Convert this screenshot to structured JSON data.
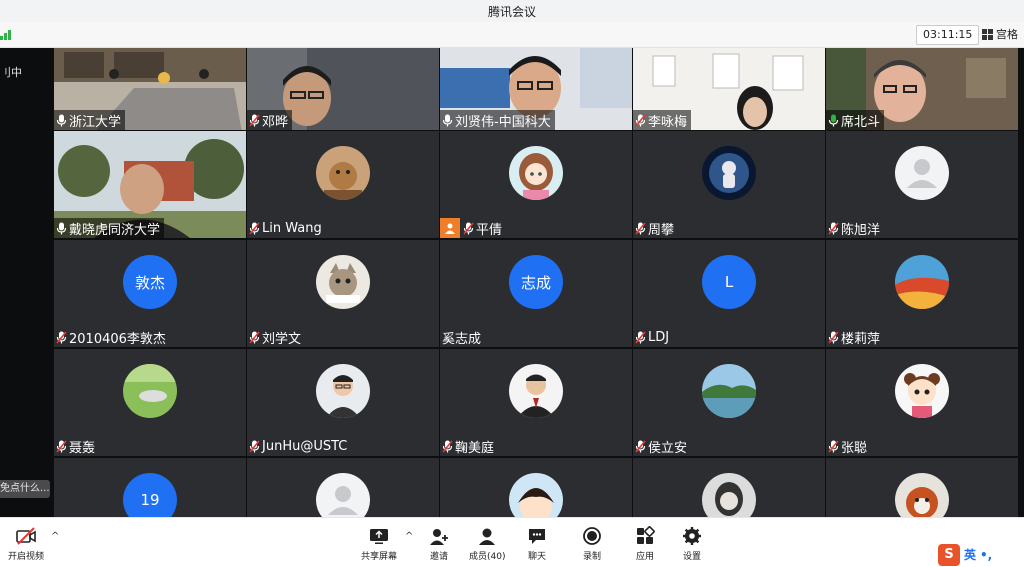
{
  "window": {
    "title": "腾讯会议"
  },
  "topbar": {
    "timer": "03:11:15",
    "layout_label": "宫格"
  },
  "sidebar": {
    "status": "刂中",
    "chat_preview": "免点什么..."
  },
  "tiles": [
    {
      "name": "浙江大学",
      "kind": "video",
      "scene": "meeting",
      "mic": "on"
    },
    {
      "name": "邓晔",
      "kind": "video",
      "scene": "man1",
      "mic": "muted"
    },
    {
      "name": "刘贤伟-中国科大",
      "kind": "video",
      "scene": "man2",
      "mic": "on"
    },
    {
      "name": "李咏梅",
      "kind": "video",
      "scene": "woman",
      "mic": "muted"
    },
    {
      "name": "席北斗",
      "kind": "video",
      "scene": "man3",
      "mic": "active"
    },
    {
      "name": "戴晓虎同济大学",
      "kind": "video",
      "scene": "outdoor",
      "mic": "on"
    },
    {
      "name": "Lin Wang",
      "kind": "avatar",
      "img": "cat",
      "mic": "muted"
    },
    {
      "name": "平倩",
      "kind": "avatar",
      "img": "anime-girl",
      "mic": "muted",
      "sharing": true
    },
    {
      "name": "周攀",
      "kind": "avatar",
      "img": "astronaut",
      "mic": "muted"
    },
    {
      "name": "陈旭洋",
      "kind": "avatar",
      "img": "default",
      "mic": "muted"
    },
    {
      "name": "2010406李敦杰",
      "kind": "avatar-text",
      "text": "敦杰",
      "mic": "muted"
    },
    {
      "name": "刘学文",
      "kind": "avatar",
      "img": "cat2",
      "mic": "muted"
    },
    {
      "name": "奚志成",
      "kind": "avatar-text",
      "text": "志成",
      "mic": "none"
    },
    {
      "name": "LDJ",
      "kind": "avatar-text",
      "text": "L",
      "mic": "muted"
    },
    {
      "name": "楼莉萍",
      "kind": "avatar",
      "img": "landscape",
      "mic": "muted"
    },
    {
      "name": "聂轰",
      "kind": "avatar",
      "img": "grass",
      "mic": "muted"
    },
    {
      "name": "JunHu@USTC",
      "kind": "avatar",
      "img": "man-glasses",
      "mic": "muted"
    },
    {
      "name": "鞠美庭",
      "kind": "avatar",
      "img": "man-suit",
      "mic": "muted"
    },
    {
      "name": "侯立安",
      "kind": "avatar",
      "img": "lake",
      "mic": "muted"
    },
    {
      "name": "张聪",
      "kind": "avatar",
      "img": "cartoon-girl",
      "mic": "muted"
    },
    {
      "name": "",
      "kind": "avatar-text",
      "text": "19",
      "mic": "none"
    },
    {
      "name": "",
      "kind": "avatar",
      "img": "default",
      "mic": "none"
    },
    {
      "name": "",
      "kind": "avatar",
      "img": "cartoon-kid",
      "mic": "none"
    },
    {
      "name": "",
      "kind": "avatar",
      "img": "woman-bw",
      "mic": "none"
    },
    {
      "name": "",
      "kind": "avatar",
      "img": "redpanda",
      "mic": "none"
    }
  ],
  "toolbar": {
    "video_label": "开启视频",
    "items": [
      {
        "label": "共享屏幕",
        "icon": "share-screen-icon"
      },
      {
        "label": "邀请",
        "icon": "invite-icon"
      },
      {
        "label": "成员(40)",
        "icon": "members-icon"
      },
      {
        "label": "聊天",
        "icon": "chat-icon"
      },
      {
        "label": "录制",
        "icon": "record-icon"
      },
      {
        "label": "应用",
        "icon": "apps-icon"
      },
      {
        "label": "设置",
        "icon": "settings-icon"
      }
    ]
  },
  "ime": {
    "mode": "英",
    "punct": "•,"
  },
  "colors": {
    "accent": "#1f70f2",
    "mic_active": "#2fb344",
    "share_badge": "#f07d2a"
  }
}
